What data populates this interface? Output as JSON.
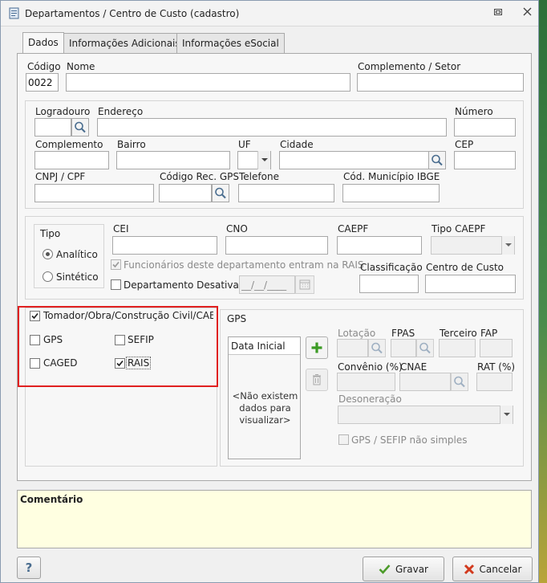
{
  "window": {
    "title": "Departamentos / Centro de Custo (cadastro)"
  },
  "tabs": [
    {
      "label": "Dados"
    },
    {
      "label": "Informações Adicionais"
    },
    {
      "label": "Informações eSocial"
    }
  ],
  "fields": {
    "codigo": {
      "label": "Código",
      "value": "0022"
    },
    "nome": {
      "label": "Nome",
      "value": ""
    },
    "complemento_setor": {
      "label": "Complemento / Setor",
      "value": ""
    },
    "logradouro": {
      "label": "Logradouro",
      "value": ""
    },
    "endereco": {
      "label": "Endereço",
      "value": ""
    },
    "numero": {
      "label": "Número",
      "value": ""
    },
    "complemento": {
      "label": "Complemento",
      "value": ""
    },
    "bairro": {
      "label": "Bairro",
      "value": ""
    },
    "uf": {
      "label": "UF",
      "value": ""
    },
    "cidade": {
      "label": "Cidade",
      "value": ""
    },
    "cep": {
      "label": "CEP",
      "value": ""
    },
    "cnpj_cpf": {
      "label": "CNPJ / CPF",
      "value": ""
    },
    "codigo_rec_gps": {
      "label": "Código Rec. GPS",
      "value": ""
    },
    "telefone": {
      "label": "Telefone",
      "value": ""
    },
    "cod_municipio_ibge": {
      "label": "Cód. Município IBGE",
      "value": ""
    },
    "cei": {
      "label": "CEI",
      "value": ""
    },
    "cno": {
      "label": "CNO",
      "value": ""
    },
    "caepf": {
      "label": "CAEPF",
      "value": ""
    },
    "tipo_caepf": {
      "label": "Tipo CAEPF",
      "value": ""
    },
    "classificacao": {
      "label": "Classificação",
      "value": ""
    },
    "centro_de_custo": {
      "label": "Centro de Custo",
      "value": ""
    }
  },
  "tipo": {
    "label": "Tipo",
    "options": [
      {
        "label": "Analítico",
        "selected": true
      },
      {
        "label": "Sintético",
        "selected": false
      }
    ]
  },
  "checks": {
    "funcionarios_rais": {
      "label": "Funcionários deste departamento entram na RAIS",
      "checked": true,
      "enabled": false
    },
    "departamento_desativado": {
      "label": "Departamento Desativado",
      "checked": false,
      "enabled": true
    },
    "date_placeholder": "__/__/____"
  },
  "tomador": {
    "label": "Tomador/Obra/Construção Civil/CAEPF",
    "checked": true,
    "items": [
      {
        "label": "GPS",
        "checked": false
      },
      {
        "label": "SEFIP",
        "checked": false
      },
      {
        "label": "CAGED",
        "checked": false
      },
      {
        "label": "RAIS",
        "checked": true
      }
    ]
  },
  "gps": {
    "title": "GPS",
    "list_header": "Data Inicial",
    "empty_text": "<Não existem dados para visualizar>",
    "lotacao": "Lotação",
    "fpas": "FPAS",
    "terceiro": "Terceiro",
    "fap": "FAP",
    "convenio": "Convênio (%)",
    "cnae": "CNAE",
    "rat": "RAT (%)",
    "desoneracao": "Desoneração",
    "gps_sefip_label": "GPS / SEFIP não simples"
  },
  "comentario": {
    "label": "Comentário"
  },
  "buttons": {
    "help": "?",
    "gravar": "Gravar",
    "cancelar": "Cancelar"
  },
  "colors": {
    "accent_red": "#e02020",
    "comment_bg": "#ffffe1",
    "add_green": "#3c9b25",
    "cancel_red": "#d23a1e"
  }
}
